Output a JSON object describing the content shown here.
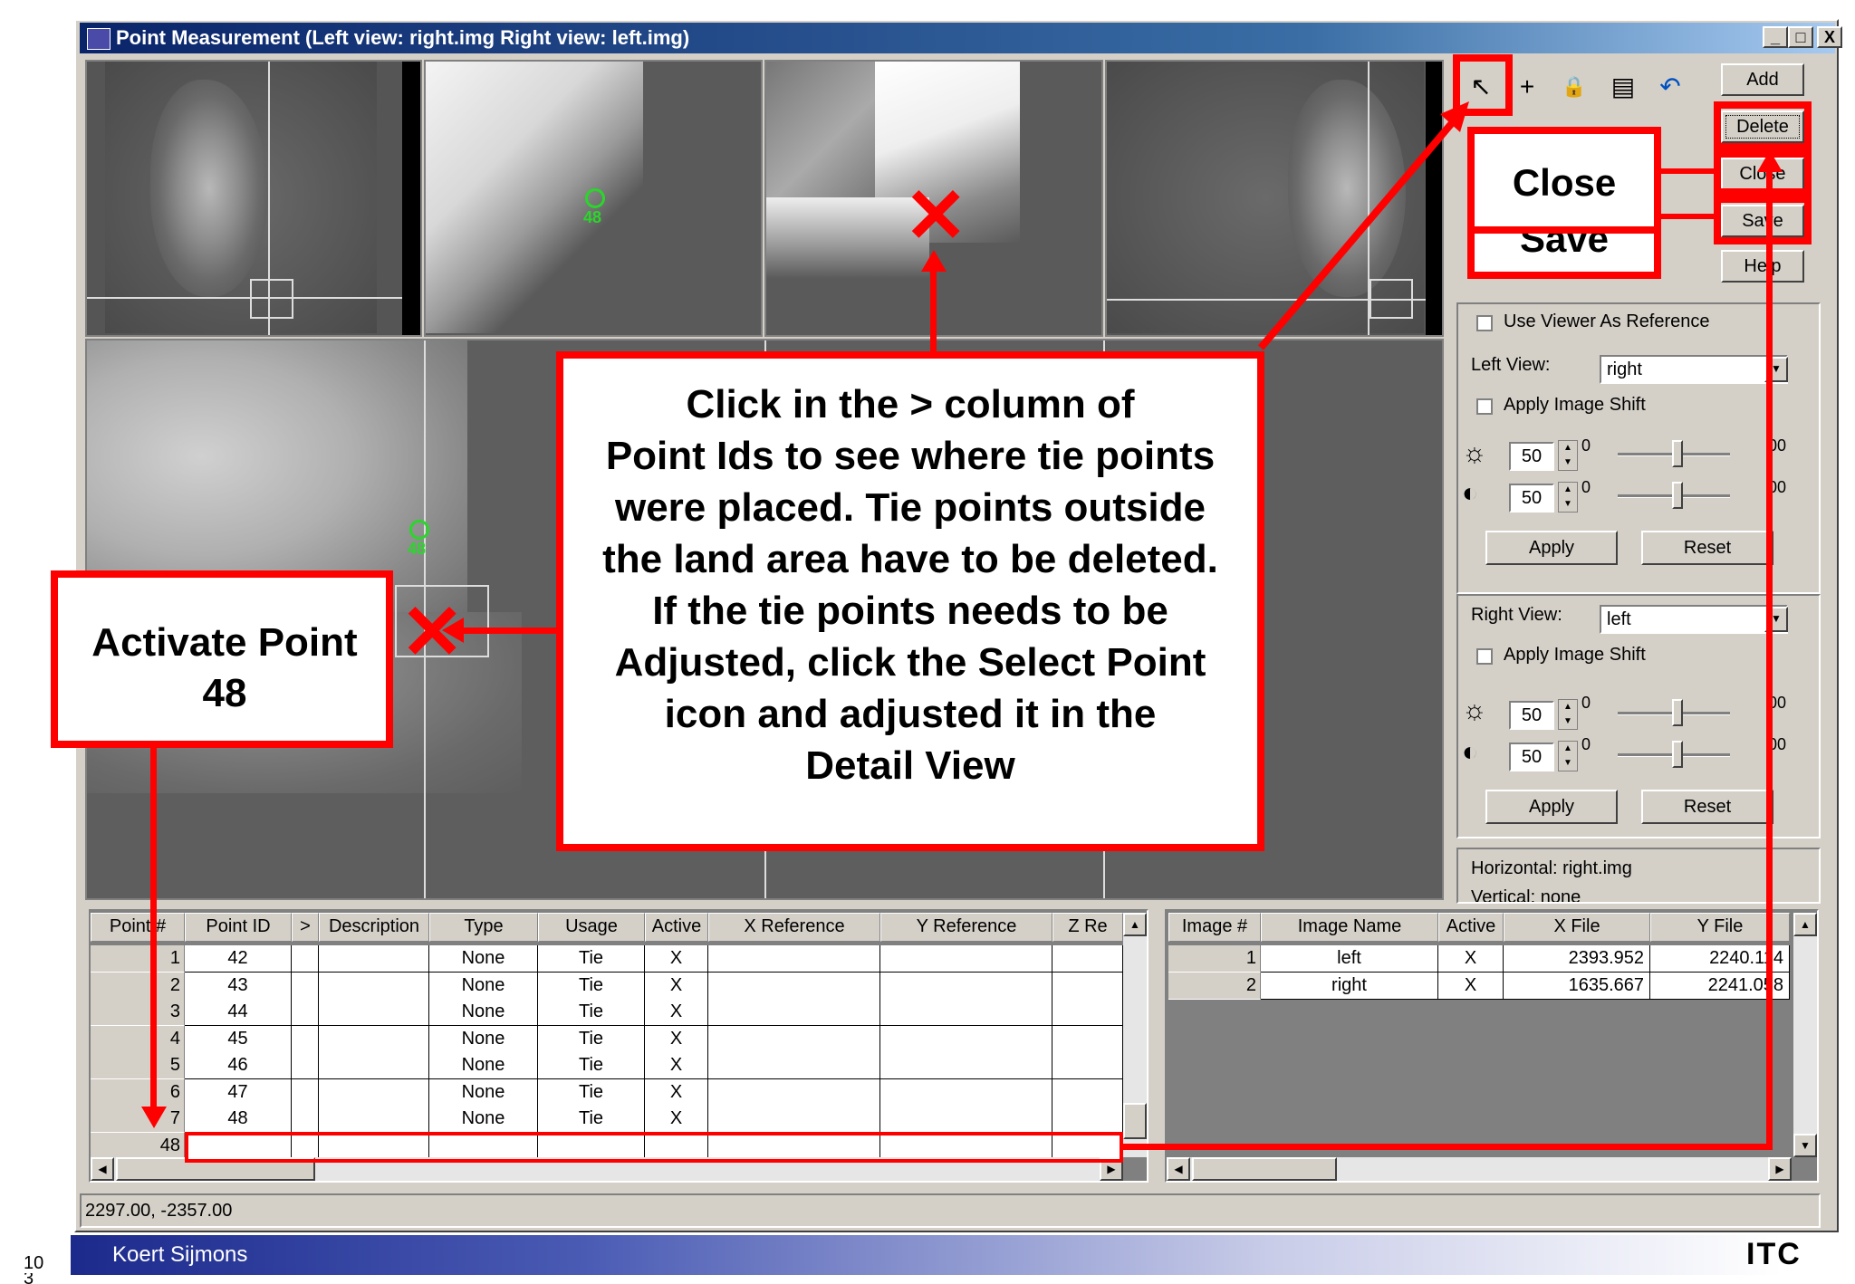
{
  "window": {
    "title": "Point Measurement (Left view: right.img  Right view: left.img)",
    "minimize": "_",
    "maximize": "□",
    "close": "X"
  },
  "panes": {
    "overview_left_point": "48",
    "overview_right_point": "48",
    "main_point": "48"
  },
  "toolbar": {
    "icons": [
      "select-point-icon",
      "create-point-icon",
      "lock-icon",
      "viewer-icon",
      "undo-icon"
    ],
    "select": "↖",
    "create": "+",
    "lock": "🔒",
    "viewer": "▤",
    "undo": "↶"
  },
  "side_buttons": {
    "add": "Add",
    "delete": "Delete",
    "close": "Close",
    "save": "Save",
    "help": "Help"
  },
  "left_view": {
    "use_viewer_ref": "Use Viewer As Reference",
    "label": "Left View:",
    "value": "right",
    "apply_shift": "Apply Image Shift",
    "brightness": "50",
    "contrast": "50",
    "bright_zero": "0",
    "contrast_zero": "0",
    "bright_max": "00",
    "contrast_max": "00",
    "apply": "Apply",
    "reset": "Reset"
  },
  "right_view": {
    "label": "Right View:",
    "value": "left",
    "apply_shift": "Apply Image Shift",
    "brightness": "50",
    "contrast": "50",
    "bright_zero": "0",
    "contrast_zero": "0",
    "bright_max": "00",
    "contrast_max": "00",
    "apply": "Apply",
    "reset": "Reset"
  },
  "info": {
    "horizontal": "Horizontal: right.img",
    "vertical": "Vertical: none"
  },
  "point_table": {
    "headers": [
      "Point #",
      "Point ID",
      ">",
      "Description",
      "Type",
      "Usage",
      "Active",
      "X Reference",
      "Y Reference",
      "Z Re"
    ],
    "rows": [
      {
        "num": "1",
        "id": "42",
        "type": "None",
        "usage": "Tie",
        "active": "X"
      },
      {
        "num": "2",
        "id": "43",
        "type": "None",
        "usage": "Tie",
        "active": "X"
      },
      {
        "num": "3",
        "id": "44",
        "type": "None",
        "usage": "Tie",
        "active": "X"
      },
      {
        "num": "4",
        "id": "45",
        "type": "None",
        "usage": "Tie",
        "active": "X"
      },
      {
        "num": "5",
        "id": "46",
        "type": "None",
        "usage": "Tie",
        "active": "X"
      },
      {
        "num": "6",
        "id": "47",
        "type": "None",
        "usage": "Tie",
        "active": "X"
      },
      {
        "num": "7",
        "id": "48",
        "type": "None",
        "usage": "Tie",
        "active": "X"
      },
      {
        "num": "48",
        "id": "",
        "type": "",
        "usage": "",
        "active": ""
      }
    ]
  },
  "image_table": {
    "headers": [
      "Image #",
      "Image Name",
      "Active",
      "X File",
      "Y File"
    ],
    "rows": [
      {
        "num": "1",
        "name": "left",
        "active": "X",
        "x": "2393.952",
        "y": "2240.114"
      },
      {
        "num": "2",
        "name": "right",
        "active": "X",
        "x": "1635.667",
        "y": "2241.058"
      }
    ]
  },
  "status": {
    "coords": "2297.00, -2357.00"
  },
  "callouts": {
    "close": "Close",
    "save": "Save",
    "activate": "Activate Point 48",
    "main_lines": [
      "Click in the > column of",
      "Point Ids to see where tie points",
      "were placed. Tie points outside",
      "the land area have to be deleted.",
      "If the tie points needs to be",
      "Adjusted, click the Select Point",
      "icon and adjusted it in the",
      "Detail View"
    ],
    "x_mark": "✕"
  },
  "footer": {
    "author": "Koert Sijmons",
    "logo": "ITC",
    "page": "10",
    "page2": "3"
  }
}
